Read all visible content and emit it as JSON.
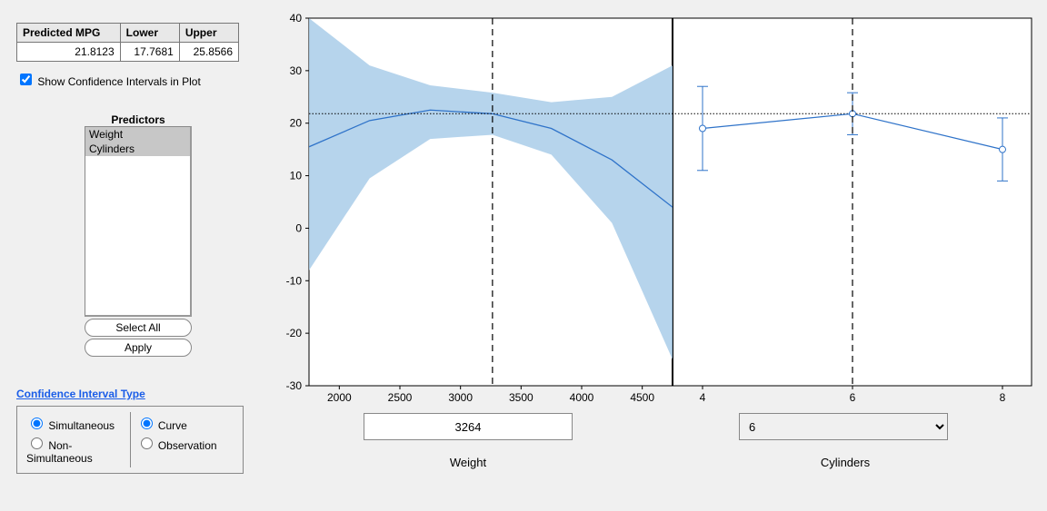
{
  "table": {
    "headers": [
      "Predicted MPG",
      "Lower",
      "Upper"
    ],
    "row": [
      "21.8123",
      "17.7681",
      "25.8566"
    ]
  },
  "show_ci_label": "Show Confidence Intervals in Plot",
  "predictors_heading": "Predictors",
  "predictor_list": [
    "Weight",
    "Cylinders"
  ],
  "select_all_label": "Select All",
  "apply_label": "Apply",
  "ci_heading": "Confidence Interval Type",
  "ci_left": {
    "opt1": "Simultaneous",
    "opt2": "Non-Simultaneous"
  },
  "ci_right": {
    "opt1": "Curve",
    "opt2": "Observation"
  },
  "weight_value": "3264",
  "cyl_value": "6",
  "axis_weight": "Weight",
  "axis_cyl": "Cylinders",
  "chart_data": {
    "type": "line",
    "panels": [
      {
        "predictor": "Weight",
        "x_range": [
          1750,
          4750
        ],
        "x_ticks": [
          2000,
          2500,
          3000,
          3500,
          4000,
          4500
        ],
        "fit": {
          "x": [
            1750,
            2250,
            2750,
            3264,
            3750,
            4250,
            4750
          ],
          "y": [
            15.5,
            20.5,
            22.5,
            21.8,
            19.0,
            13.0,
            4.0
          ]
        },
        "ci_lower": {
          "x": [
            1750,
            2250,
            2750,
            3264,
            3750,
            4250,
            4750
          ],
          "y": [
            -8.0,
            9.5,
            17.0,
            17.8,
            14.0,
            1.0,
            -25.0
          ]
        },
        "ci_upper": {
          "x": [
            1750,
            2250,
            2750,
            3264,
            3750,
            4250,
            4750
          ],
          "y": [
            40.0,
            31.0,
            27.2,
            25.8,
            24.0,
            25.0,
            31.0
          ]
        },
        "vline": 3264
      },
      {
        "predictor": "Cylinders",
        "x_values": [
          4,
          6,
          8
        ],
        "y": [
          19.0,
          21.8,
          15.0
        ],
        "err_lower": [
          11.0,
          17.8,
          9.0
        ],
        "err_upper": [
          27.0,
          25.8,
          21.0
        ],
        "vline": 6
      }
    ],
    "y_range": [
      -30,
      40
    ],
    "y_ticks": [
      -30,
      -20,
      -10,
      0,
      10,
      20,
      30,
      40
    ],
    "hline": 21.8
  }
}
